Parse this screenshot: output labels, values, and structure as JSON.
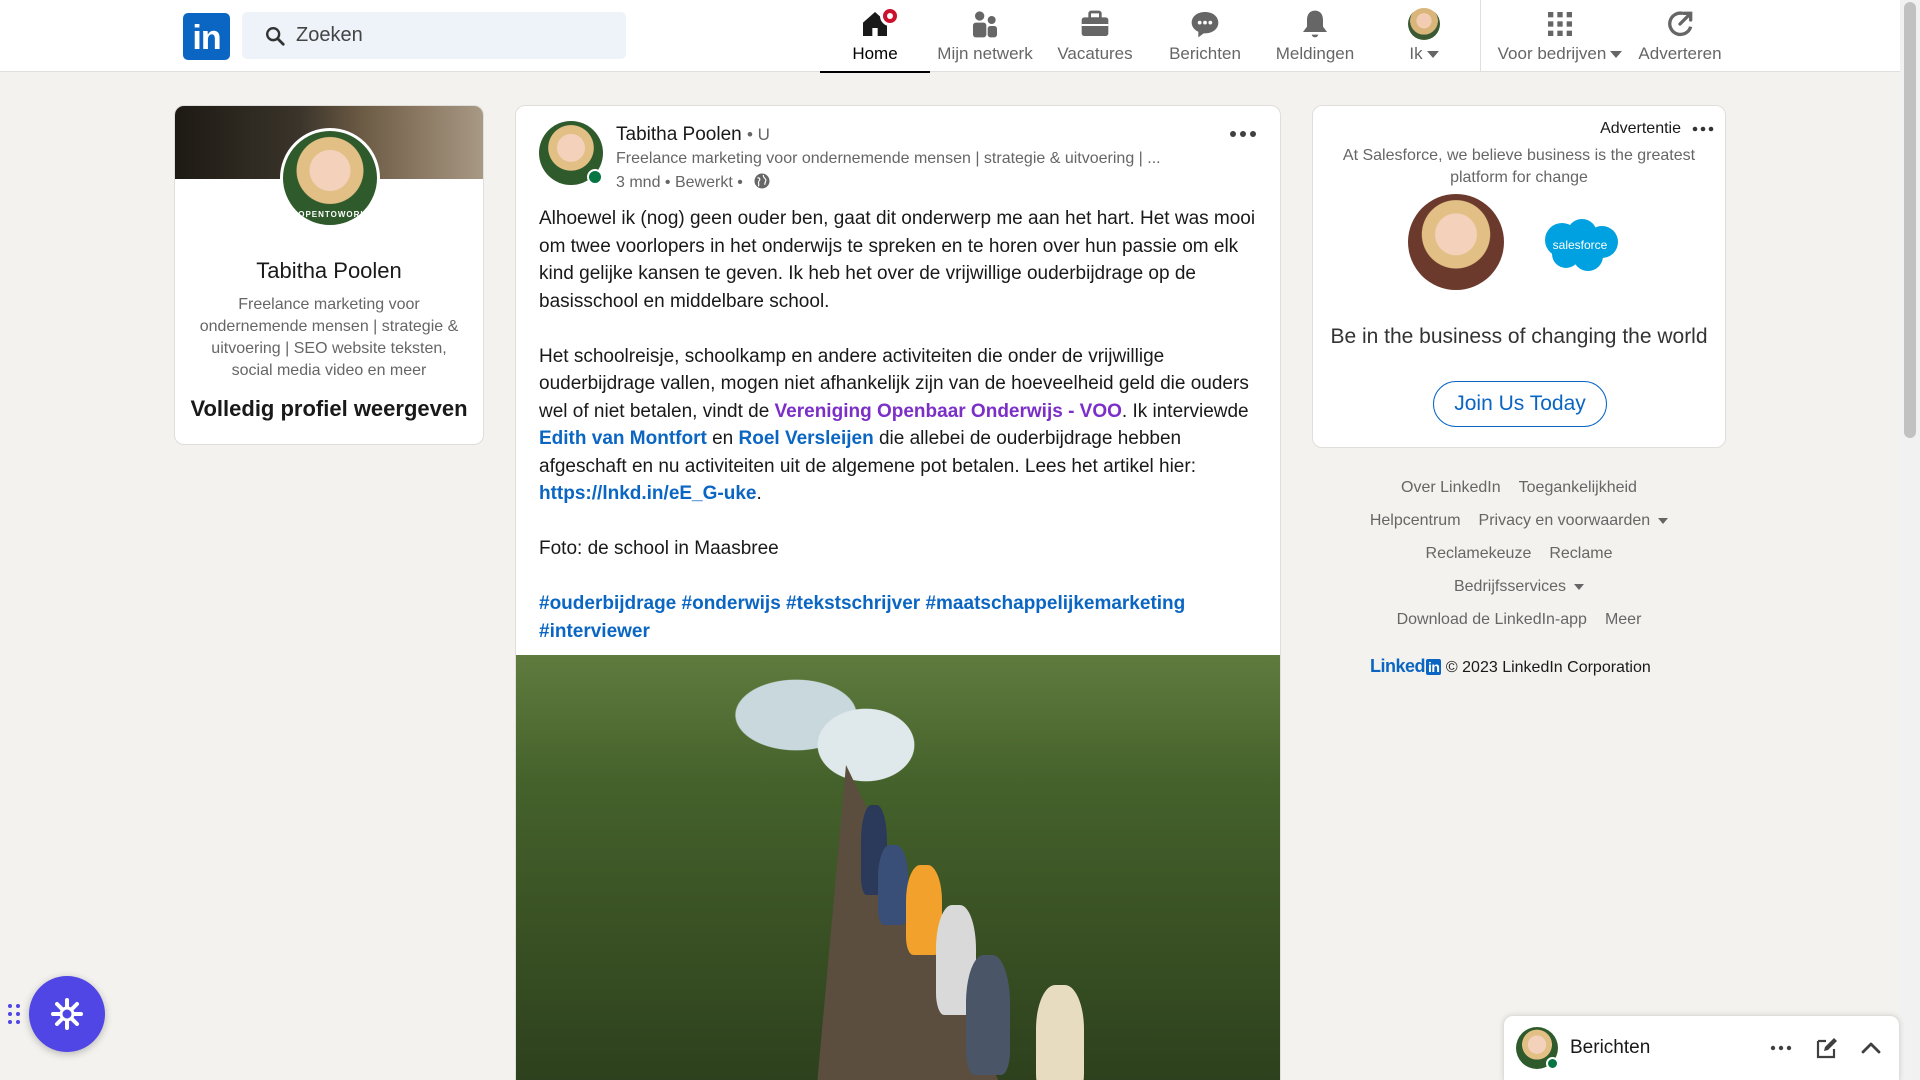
{
  "nav": {
    "logo_text": "in",
    "search_placeholder": "Zoeken",
    "items": [
      {
        "label": "Home",
        "icon": "home-icon"
      },
      {
        "label": "Mijn netwerk",
        "icon": "network-icon"
      },
      {
        "label": "Vacatures",
        "icon": "briefcase-icon"
      },
      {
        "label": "Berichten",
        "icon": "chat-icon"
      },
      {
        "label": "Meldingen",
        "icon": "bell-icon"
      },
      {
        "label": "Ik",
        "icon": "avatar"
      },
      {
        "label": "Voor bedrijven",
        "icon": "grid-icon"
      },
      {
        "label": "Adverteren",
        "icon": "megaphone-icon"
      }
    ]
  },
  "profile": {
    "name": "Tabitha Poolen",
    "open_to_work": "#OPENTOWORK",
    "headline": "Freelance marketing voor ondernemende mensen | strategie & uitvoering | SEO website teksten, social media video en meer",
    "view_profile": "Volledig profiel weergeven"
  },
  "post": {
    "author": "Tabitha Poolen",
    "degree": "• U",
    "headline": "Freelance marketing voor ondernemende mensen | strategie & uitvoering | ...",
    "meta": "3 mnd • Bewerkt •",
    "p1": "Alhoewel ik (nog) geen ouder ben, gaat dit onderwerp me aan het hart. Het was mooi om twee voorlopers in het onderwijs te spreken en te horen over hun passie om elk kind gelijke kansen te geven. Ik heb het over de vrijwillige ouderbijdrage op de basisschool en middelbare school.",
    "p2_a": "Het schoolreisje, schoolkamp en andere activiteiten die onder de vrijwillige ouderbijdrage vallen, mogen niet afhankelijk zijn van de hoeveelheid geld die ouders wel of niet betalen, vindt de ",
    "p2_org": "Vereniging Openbaar Onderwijs - VOO",
    "p2_b": ". Ik interviewde ",
    "p2_m1": "Edith van Montfort",
    "p2_c": " en ",
    "p2_m2": "Roel Versleijen",
    "p2_d": " die allebei de ouderbijdrage hebben afgeschaft en nu activiteiten uit de algemene pot betalen. Lees het artikel hier: ",
    "p2_link": "https://lnkd.in/eE_G-uke",
    "p2_e": ".",
    "p3": "Foto: de school in Maasbree",
    "hashtags": "#ouderbijdrage #onderwijs #tekstschrijver #maatschappelijkemarketing #interviewer"
  },
  "ad": {
    "label": "Advertentie",
    "text": "At Salesforce, we believe business is the greatest platform for change",
    "brand": "salesforce",
    "headline": "Be in the business of changing the world",
    "cta": "Join Us Today"
  },
  "footer": {
    "links": {
      "about": "Over LinkedIn",
      "accessibility": "Toegankelijkheid",
      "help": "Helpcentrum",
      "privacy": "Privacy en voorwaarden",
      "ad_choices": "Reclamekeuze",
      "advertising": "Reclame",
      "business": "Bedrijfsservices",
      "app": "Download de LinkedIn-app",
      "more": "Meer"
    },
    "brand_word": "Linked",
    "brand_in": "in",
    "copyright": "© 2023 LinkedIn Corporation"
  },
  "messaging": {
    "title": "Berichten"
  },
  "colors": {
    "brand": "#0a66c2",
    "background": "#f4f2ee",
    "org_mention": "#7b2fc7",
    "float_button": "#4f46e5"
  }
}
